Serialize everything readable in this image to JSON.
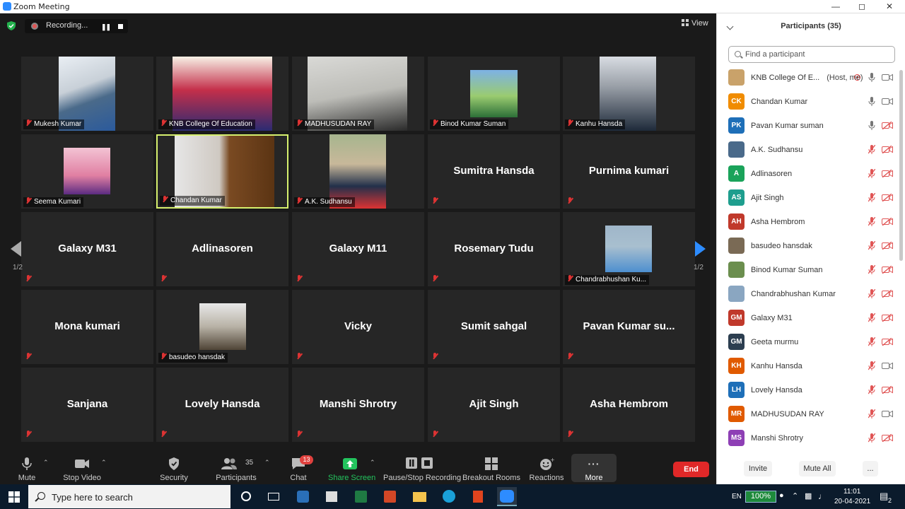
{
  "window": {
    "title": "Zoom Meeting"
  },
  "recording": {
    "label": "Recording..."
  },
  "view": {
    "label": "View"
  },
  "pager": {
    "left": "1/2",
    "right": "1/2"
  },
  "tiles": [
    {
      "name": "Mukesh Kumar",
      "big": "",
      "photo": "p1",
      "active": false
    },
    {
      "name": "KNB College Of Education",
      "big": "",
      "photo": "p2",
      "active": false
    },
    {
      "name": "MADHUSUDAN RAY",
      "big": "",
      "photo": "p3",
      "active": false
    },
    {
      "name": "Binod Kumar Suman",
      "big": "",
      "photo": "p4",
      "active": false
    },
    {
      "name": "Kanhu Hansda",
      "big": "",
      "photo": "p5",
      "active": false
    },
    {
      "name": "Seema Kumari",
      "big": "",
      "photo": "p6",
      "active": false
    },
    {
      "name": "Chandan Kumar",
      "big": "",
      "photo": "p7",
      "active": true
    },
    {
      "name": "A.K. Sudhansu",
      "big": "",
      "photo": "p8",
      "active": false
    },
    {
      "name": "",
      "big": "Sumitra Hansda",
      "photo": "",
      "active": false
    },
    {
      "name": "",
      "big": "Purnima kumari",
      "photo": "",
      "active": false
    },
    {
      "name": "",
      "big": "Galaxy M31",
      "photo": "",
      "active": false
    },
    {
      "name": "",
      "big": "Adlinasoren",
      "photo": "",
      "active": false
    },
    {
      "name": "",
      "big": "Galaxy M11",
      "photo": "",
      "active": false
    },
    {
      "name": "",
      "big": "Rosemary Tudu",
      "photo": "",
      "active": false
    },
    {
      "name": "Chandrabhushan Ku...",
      "big": "",
      "photo": "p9",
      "active": false
    },
    {
      "name": "",
      "big": "Mona kumari",
      "photo": "",
      "active": false
    },
    {
      "name": "basudeo hansdak",
      "big": "",
      "photo": "p10",
      "active": false
    },
    {
      "name": "",
      "big": "Vicky",
      "photo": "",
      "active": false
    },
    {
      "name": "",
      "big": "Sumit sahgal",
      "photo": "",
      "active": false
    },
    {
      "name": "",
      "big": "Pavan Kumar su...",
      "photo": "",
      "active": false
    },
    {
      "name": "",
      "big": "Sanjana",
      "photo": "",
      "active": false
    },
    {
      "name": "",
      "big": "Lovely Hansda",
      "photo": "",
      "active": false
    },
    {
      "name": "",
      "big": "Manshi Shrotry",
      "photo": "",
      "active": false
    },
    {
      "name": "",
      "big": "Ajit Singh",
      "photo": "",
      "active": false
    },
    {
      "name": "",
      "big": "Asha Hembrom",
      "photo": "",
      "active": false
    }
  ],
  "toolbar": {
    "mute": "Mute",
    "stop_video": "Stop Video",
    "security": "Security",
    "participants": "Participants",
    "participants_count": "35",
    "chat": "Chat",
    "chat_badge": "13",
    "share_screen": "Share Screen",
    "pause_stop_recording": "Pause/Stop Recording",
    "breakout_rooms": "Breakout Rooms",
    "reactions": "Reactions",
    "more": "More",
    "end": "End"
  },
  "panel": {
    "title": "Participants (35)",
    "search_placeholder": "Find a participant",
    "host_tag": "(Host, me)",
    "participants": [
      {
        "name": "KNB College Of E...",
        "initials": "",
        "color": "#c9a26a",
        "mic": "on",
        "cam": "on",
        "host": true
      },
      {
        "name": "Chandan Kumar",
        "initials": "CK",
        "color": "#f08c00",
        "mic": "on",
        "cam": "on",
        "host": false
      },
      {
        "name": "Pavan Kumar suman",
        "initials": "PK",
        "color": "#1e6fb8",
        "mic": "on",
        "cam": "off",
        "host": false
      },
      {
        "name": "A.K. Sudhansu",
        "initials": "",
        "color": "#4a6a8a",
        "mic": "off",
        "cam": "off",
        "host": false
      },
      {
        "name": "Adlinasoren",
        "initials": "A",
        "color": "#1aa35a",
        "mic": "off",
        "cam": "off",
        "host": false
      },
      {
        "name": "Ajit Singh",
        "initials": "AS",
        "color": "#1e9e8e",
        "mic": "off",
        "cam": "off",
        "host": false
      },
      {
        "name": "Asha Hembrom",
        "initials": "AH",
        "color": "#c0392b",
        "mic": "off",
        "cam": "off",
        "host": false
      },
      {
        "name": "basudeo hansdak",
        "initials": "",
        "color": "#7a6a55",
        "mic": "off",
        "cam": "off",
        "host": false
      },
      {
        "name": "Binod Kumar Suman",
        "initials": "",
        "color": "#6b8e4e",
        "mic": "off",
        "cam": "off",
        "host": false
      },
      {
        "name": "Chandrabhushan Kumar",
        "initials": "",
        "color": "#8aa6c1",
        "mic": "off",
        "cam": "off",
        "host": false
      },
      {
        "name": "Galaxy M31",
        "initials": "GM",
        "color": "#c0392b",
        "mic": "off",
        "cam": "off",
        "host": false
      },
      {
        "name": "Geeta murmu",
        "initials": "GM",
        "color": "#2c3e50",
        "mic": "off",
        "cam": "off",
        "host": false
      },
      {
        "name": "Kanhu Hansda",
        "initials": "KH",
        "color": "#e05a00",
        "mic": "off",
        "cam": "on",
        "host": false
      },
      {
        "name": "Lovely Hansda",
        "initials": "LH",
        "color": "#1e6fb8",
        "mic": "off",
        "cam": "off",
        "host": false
      },
      {
        "name": "MADHUSUDAN RAY",
        "initials": "MR",
        "color": "#e05a00",
        "mic": "off",
        "cam": "on",
        "host": false
      },
      {
        "name": "Manshi Shrotry",
        "initials": "MS",
        "color": "#8e3fb5",
        "mic": "off",
        "cam": "off",
        "host": false
      }
    ],
    "invite": "Invite",
    "mute_all": "Mute All",
    "more": "..."
  },
  "taskbar": {
    "search_placeholder": "Type here to search",
    "lang": "EN",
    "battery": "100%",
    "time": "11:01",
    "date": "20-04-2021",
    "notif_count": "2"
  }
}
